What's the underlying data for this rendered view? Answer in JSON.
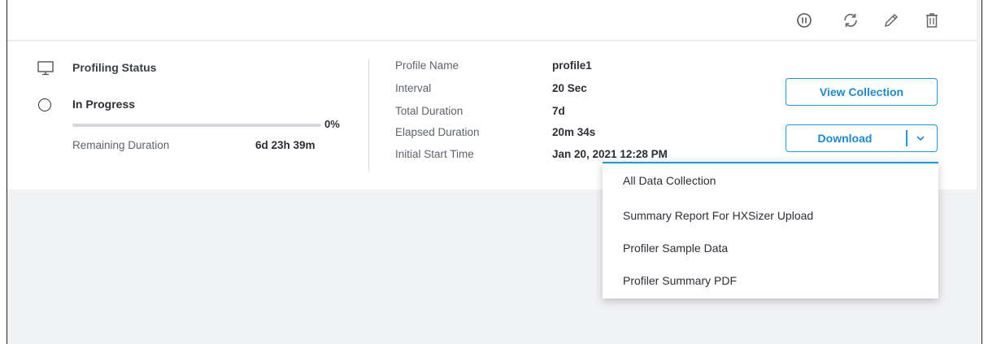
{
  "toolbar": {
    "icons": [
      "pause-icon",
      "refresh-icon",
      "edit-icon",
      "delete-icon"
    ]
  },
  "status": {
    "title": "Profiling Status",
    "value": "In Progress",
    "progress_percent": 0,
    "progress_label": "0%",
    "remaining_label": "Remaining Duration",
    "remaining_value": "6d 23h 39m"
  },
  "details": [
    {
      "label": "Profile Name",
      "value": "profile1"
    },
    {
      "label": "Interval",
      "value": "20 Sec"
    },
    {
      "label": "Total Duration",
      "value": "7d"
    },
    {
      "label": "Elapsed Duration",
      "value": "20m 34s"
    },
    {
      "label": "Initial Start Time",
      "value": "Jan 20, 2021 12:28 PM"
    }
  ],
  "buttons": {
    "view_collection": "View Collection",
    "download": "Download"
  },
  "download_menu": [
    "All Data Collection",
    "Summary Report For HXSizer Upload",
    "Profiler Sample Data",
    "Profiler Summary PDF"
  ],
  "colors": {
    "accent": "#1a9ad8",
    "background": "#f1f2f4"
  }
}
